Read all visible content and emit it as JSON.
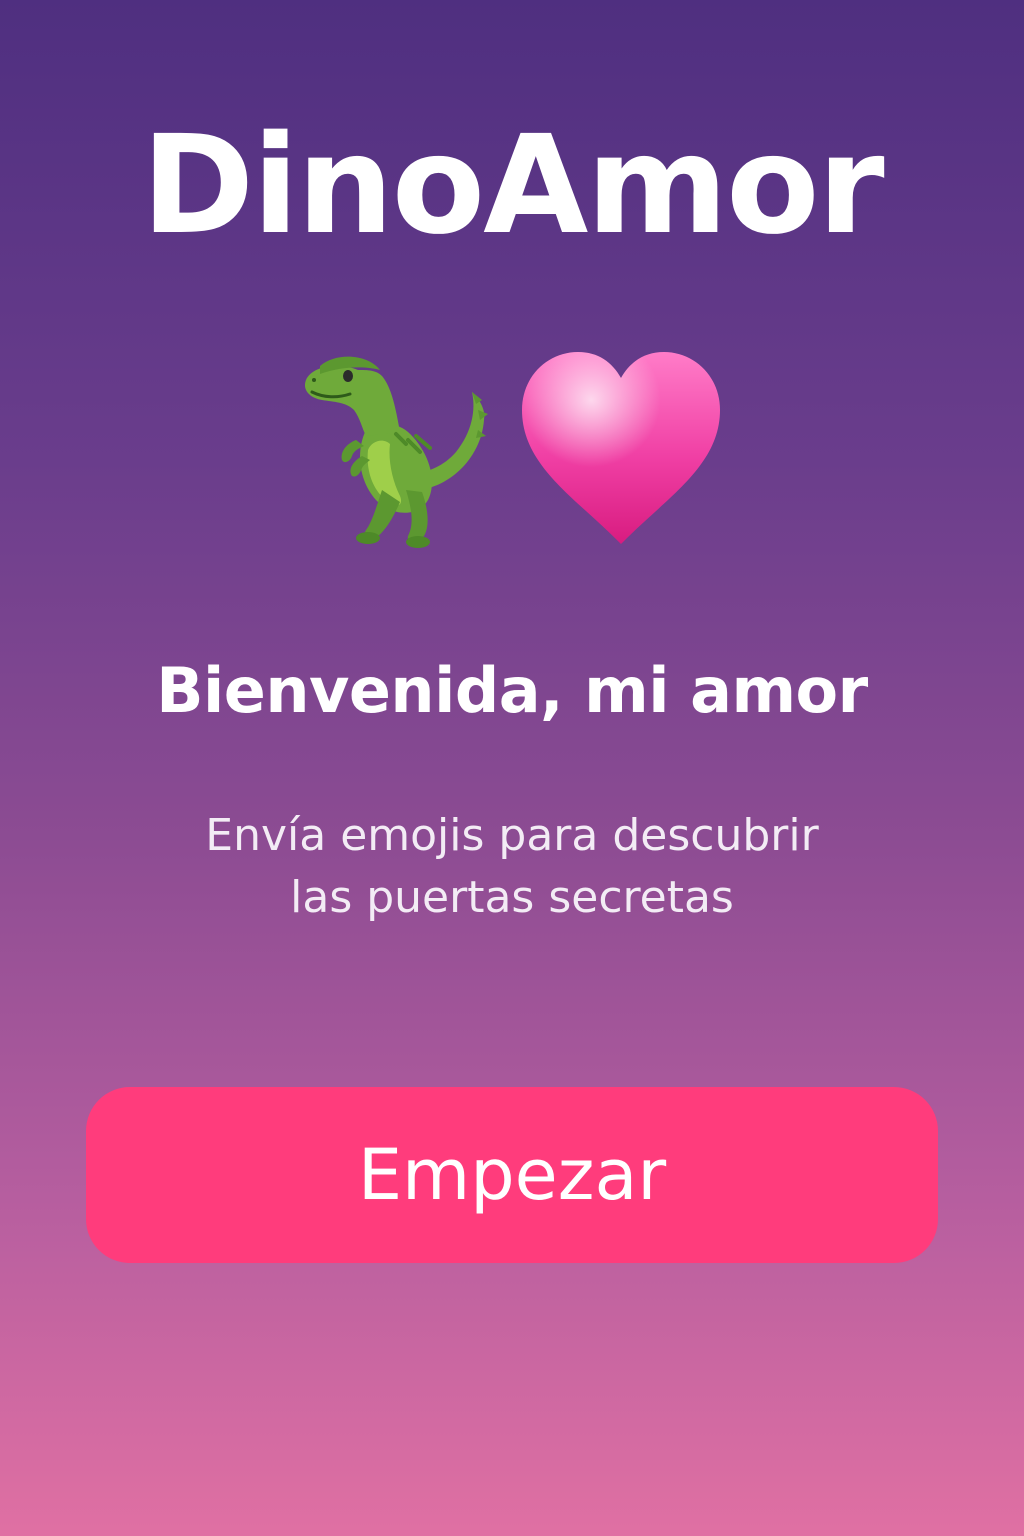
{
  "app": {
    "title": "DinoAmor"
  },
  "hero": {
    "icons": [
      "dinosaur-icon",
      "pink-heart-icon"
    ]
  },
  "welcome": {
    "heading": "Bienvenida, mi amor",
    "subtitle_line1": "Envía emojis para descubrir",
    "subtitle_line2": "las puertas secretas"
  },
  "actions": {
    "start_label": "Empezar"
  },
  "colors": {
    "background_top": "#4f2f80",
    "background_bottom": "#e070a3",
    "button": "#ff3c7c",
    "text": "#ffffff"
  }
}
